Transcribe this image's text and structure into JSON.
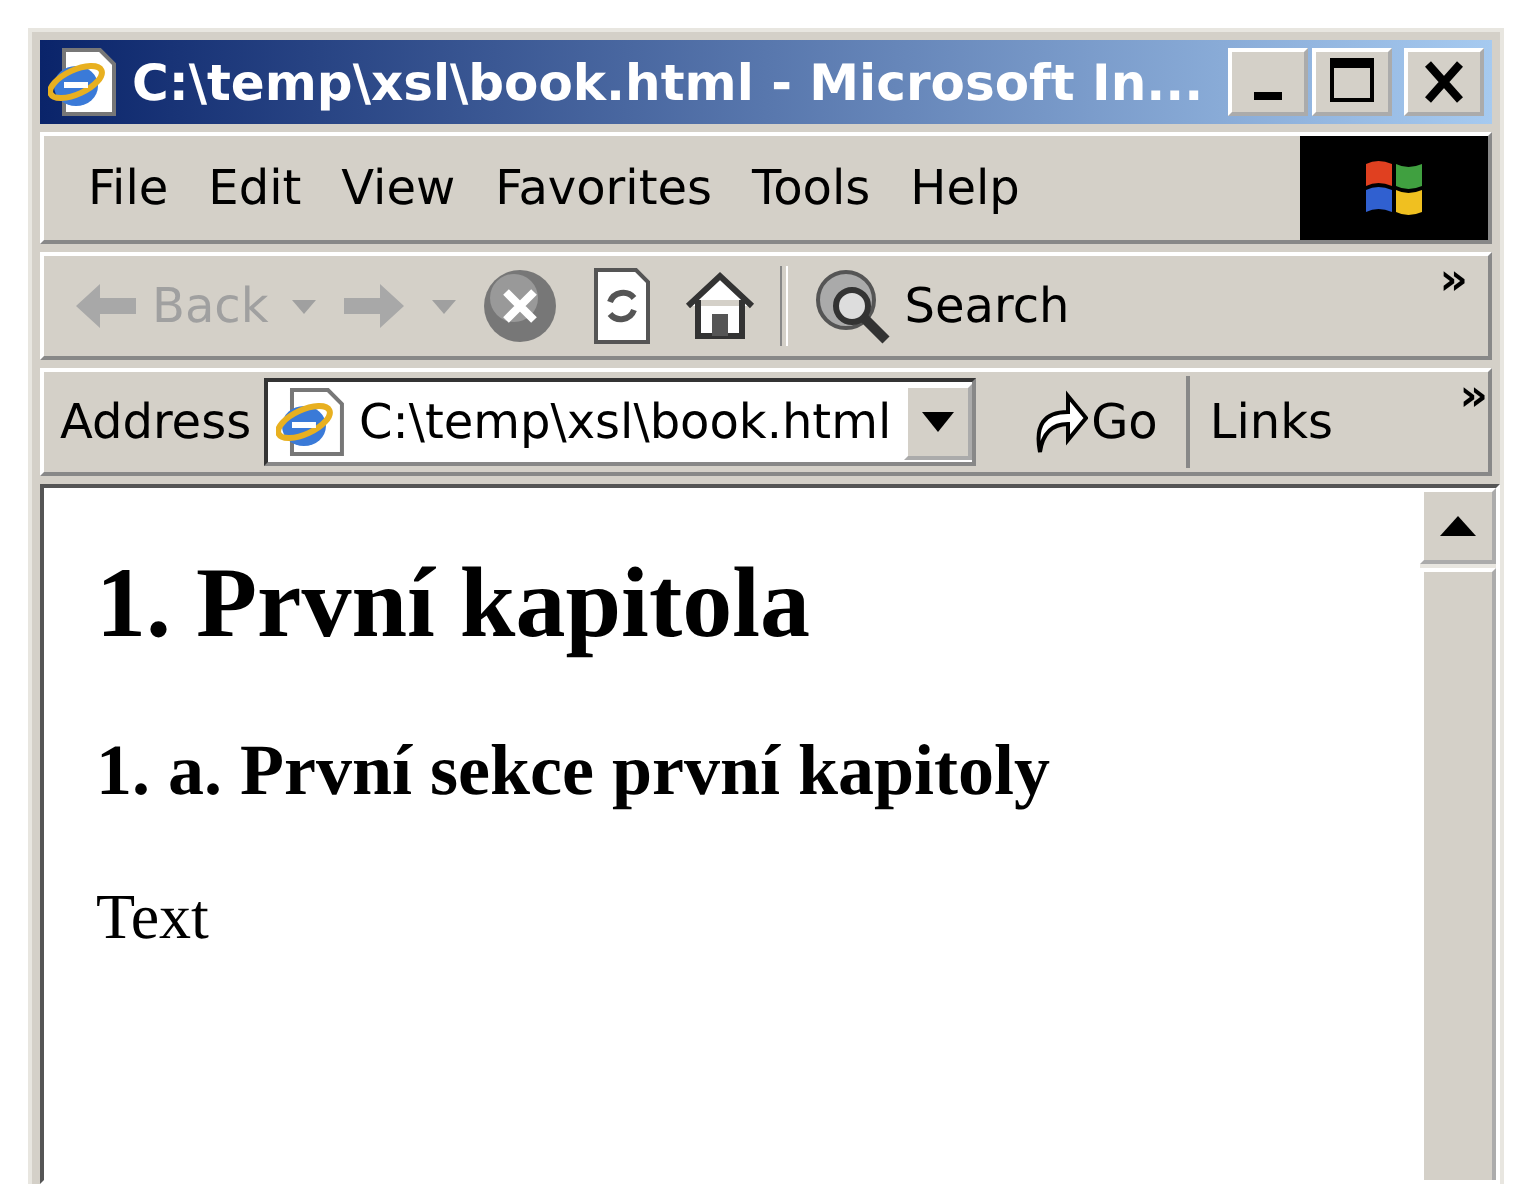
{
  "window": {
    "title": "C:\\temp\\xsl\\book.html - Microsoft In..."
  },
  "menu": [
    "File",
    "Edit",
    "View",
    "Favorites",
    "Tools",
    "Help"
  ],
  "toolbar": [
    {
      "kind": "back",
      "label": "Back",
      "disabled": true
    },
    {
      "kind": "forward",
      "disabled": true
    },
    {
      "kind": "stop"
    },
    {
      "kind": "refresh"
    },
    {
      "kind": "home"
    },
    {
      "kind": "search",
      "label": "Search"
    }
  ],
  "toolbar_more": "»",
  "address": {
    "label": "Address",
    "value": "C:\\temp\\xsl\\book.html",
    "go": "Go",
    "links": "Links",
    "more": "»"
  },
  "content": {
    "heading": "1. První kapitola",
    "subheading": "1. a. První sekce první kapitoly",
    "paragraph": "Text"
  }
}
